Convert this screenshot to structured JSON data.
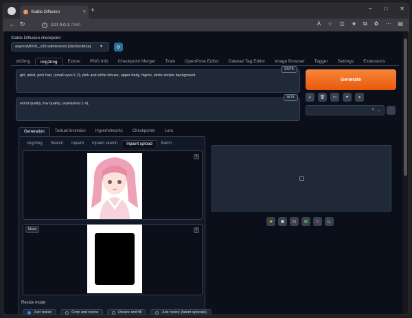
{
  "browser": {
    "tab_title": "Stable Diffusion",
    "tab_close": "×",
    "new_tab": "+",
    "url_host": "127.0.0.1",
    "url_port": ":7860",
    "window_controls": [
      "–",
      "□",
      "✕"
    ]
  },
  "checkpoint": {
    "label": "Stable Diffusion checkpoint",
    "value": "asyncsMIXXL_v30.safetensors [3ac6bc4b3a]",
    "refresh_icon": "refresh-icon"
  },
  "main_tabs": [
    "txt2img",
    "img2img",
    "Extras",
    "PNG Info",
    "Checkpoint Merger",
    "Train",
    "OpenPose Editor",
    "Dataset Tag Editor",
    "Image Browser",
    "Tagger",
    "Settings",
    "Extensions"
  ],
  "main_tab_active": "img2img",
  "prompt": {
    "value": "girl, adult, pink hair, (small eyes:1.2), pink and white blouse, upper body, higres, white simple background",
    "counter": "24/75"
  },
  "negative_prompt": {
    "value": "worst quality, low quality, (eyelashes:1.4),",
    "counter": "8/75"
  },
  "generate_label": "Generate",
  "styles": {
    "clear": "×",
    "caret": "⌄"
  },
  "sub_tabs": [
    "Generation",
    "Textual Inversion",
    "Hypernetworks",
    "Checkpoints",
    "Lora"
  ],
  "sub_tab_active": "Generation",
  "mode_tabs": [
    "img2img",
    "Sketch",
    "Inpaint",
    "Inpaint sketch",
    "Inpaint upload",
    "Batch"
  ],
  "mode_tab_active": "Inpaint upload",
  "image_close": "×",
  "mask_label": "Mask",
  "resize": {
    "label": "Resize mode",
    "options": [
      "Just resize",
      "Crop and resize",
      "Resize and fill",
      "Just resize (latent upscale)"
    ],
    "selected": "Just resize"
  },
  "colors": {
    "accent": "#ea580c",
    "bg": "#0b0f19",
    "panel": "#1f2937"
  }
}
